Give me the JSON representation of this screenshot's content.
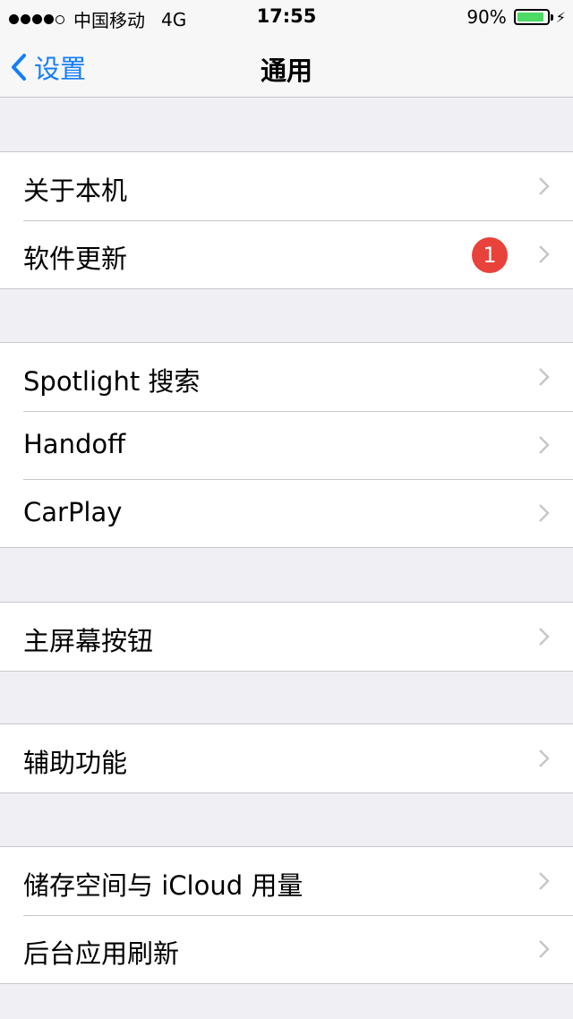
{
  "status_bar": {
    "carrier": "中国移动",
    "network": "4G",
    "time": "17:55",
    "battery_percent": "90%",
    "battery_level": 0.9,
    "battery_color": "#4cd964"
  },
  "nav": {
    "back_label": "设置",
    "title": "通用",
    "accent_color": "#157efb"
  },
  "groups": [
    {
      "items": [
        {
          "label": "关于本机"
        },
        {
          "label": "软件更新",
          "badge": "1"
        }
      ]
    },
    {
      "items": [
        {
          "label": "Spotlight 搜索"
        },
        {
          "label": "Handoff"
        },
        {
          "label": "CarPlay"
        }
      ]
    },
    {
      "items": [
        {
          "label": "主屏幕按钮"
        }
      ]
    },
    {
      "items": [
        {
          "label": "辅助功能"
        }
      ]
    },
    {
      "items": [
        {
          "label": "储存空间与 iCloud 用量"
        },
        {
          "label": "后台应用刷新"
        }
      ]
    }
  ],
  "icons": {
    "back": "chevron-left-icon",
    "disclosure": "chevron-right-icon"
  }
}
